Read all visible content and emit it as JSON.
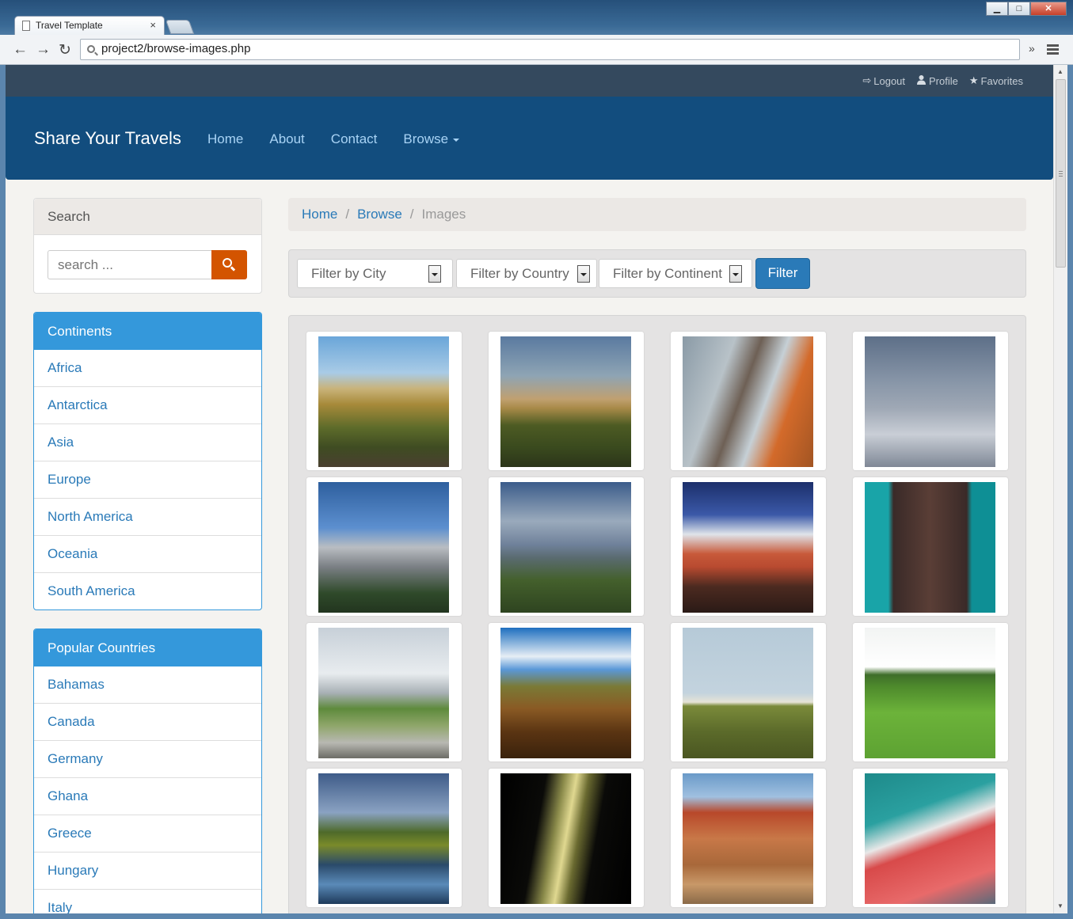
{
  "browser": {
    "tab_title": "Travel Template",
    "tab_close": "×",
    "url": "project2/browse-images.php",
    "back_icon": "←",
    "forward_icon": "→",
    "reload_icon": "↻",
    "more_icon": "»",
    "window_controls": {
      "minimize": "▁",
      "maximize": "□",
      "close": "✕"
    }
  },
  "utility_nav": {
    "logout": {
      "icon": "logout-icon",
      "glyph": "⇨",
      "label": "Logout"
    },
    "profile": {
      "icon": "user-icon",
      "glyph": "👤",
      "label": "Profile"
    },
    "favorites": {
      "icon": "star-icon",
      "glyph": "★",
      "label": "Favorites"
    }
  },
  "navbar": {
    "brand": "Share Your Travels",
    "links": {
      "home": "Home",
      "about": "About",
      "contact": "Contact",
      "browse": "Browse"
    }
  },
  "sidebar": {
    "search": {
      "title": "Search",
      "placeholder": "search ...",
      "button_icon": "search-icon"
    },
    "continents": {
      "title": "Continents",
      "items": [
        "Africa",
        "Antarctica",
        "Asia",
        "Europe",
        "North America",
        "Oceania",
        "South America"
      ]
    },
    "countries": {
      "title": "Popular Countries",
      "items": [
        "Bahamas",
        "Canada",
        "Germany",
        "Ghana",
        "Greece",
        "Hungary",
        "Italy"
      ]
    }
  },
  "breadcrumb": {
    "home": "Home",
    "browse": "Browse",
    "current": "Images",
    "separator": "/"
  },
  "filters": {
    "city": "Filter by City",
    "country": "Filter by Country",
    "continent": "Filter by Continent",
    "button": "Filter"
  },
  "gallery": {
    "images": [
      "prairie-town-autumn",
      "city-skyline-sunset",
      "snowy-tree-building",
      "snowy-path-park",
      "rocky-mountain-peak",
      "mountain-valley-clouds",
      "harbour-red-buildings",
      "gothic-church-teal",
      "rocky-coast-clouds",
      "driftwood-field",
      "white-silos-field",
      "green-field-church",
      "lake-trees-reflection",
      "skyscraper-night",
      "concert-hall-statue",
      "arsenal-stadium-sign"
    ]
  },
  "colors": {
    "util_bar": "#34495e",
    "navbar": "#124d7e",
    "accent_blue": "#3498db",
    "link": "#2a7ab8",
    "search_button": "#d35400",
    "filter_button": "#2a7ab8"
  }
}
